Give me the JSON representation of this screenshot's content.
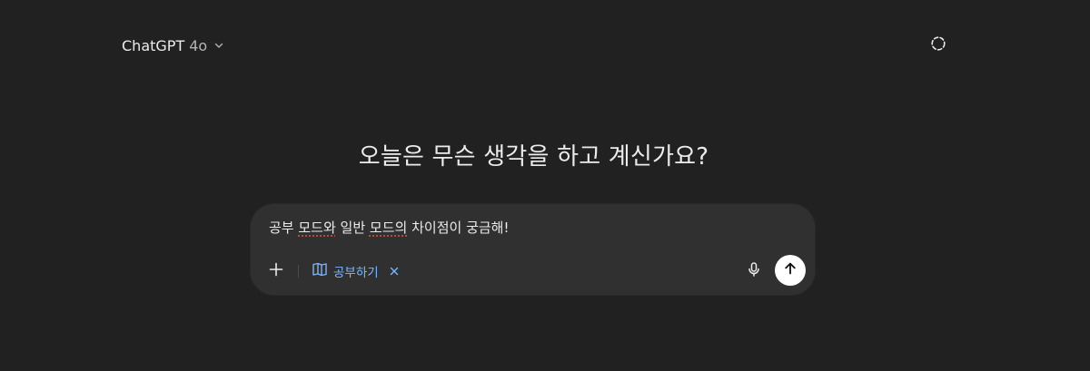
{
  "header": {
    "model_name": "ChatGPT",
    "model_version": "4o",
    "icons": {
      "dropdown": "chevron-down-icon",
      "temporary_chat": "dashed-circle-icon"
    }
  },
  "main": {
    "headline": "오늘은 무슨 생각을 하고 계신가요?"
  },
  "composer": {
    "input_value": "공부 모드와 일반 모드의 차이점이 궁금해!",
    "input_segments": {
      "s1": "공부 ",
      "s2": "모드와",
      "s3": " 일반 ",
      "s4": "모드의",
      "s5": " 차이점이 궁금해!"
    },
    "active_tool": {
      "label": "공부하기",
      "icon": "book-open-icon",
      "accent_color": "#7ab7ff"
    },
    "icons": {
      "add": "plus-icon",
      "remove_tool": "close-icon",
      "mic": "microphone-icon",
      "send": "arrow-up-icon"
    }
  },
  "colors": {
    "background": "#212121",
    "composer_background": "#303030",
    "text_primary": "#ececec",
    "text_secondary": "#b4b4b4",
    "send_button": "#ffffff"
  }
}
